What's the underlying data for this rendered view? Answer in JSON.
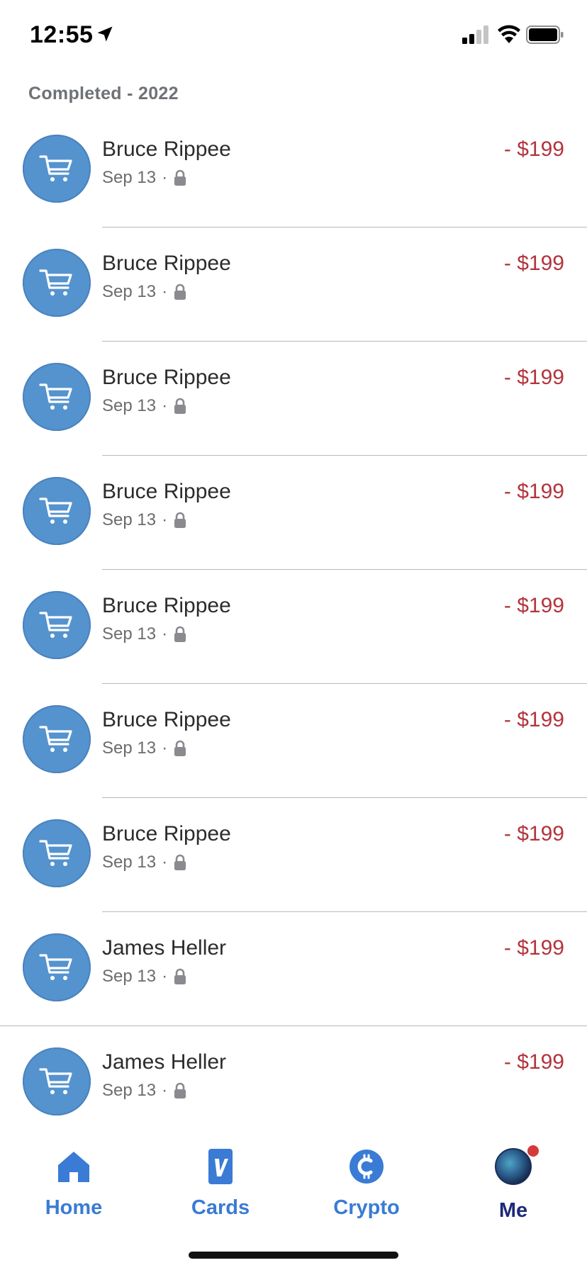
{
  "status_bar": {
    "time": "12:55"
  },
  "section": {
    "title": "Completed - 2022"
  },
  "transactions": [
    {
      "name": "Bruce Rippee",
      "date": "Sep 13",
      "separator": "·",
      "amount": "- $199"
    },
    {
      "name": "Bruce Rippee",
      "date": "Sep 13",
      "separator": "·",
      "amount": "- $199"
    },
    {
      "name": "Bruce Rippee",
      "date": "Sep 13",
      "separator": "·",
      "amount": "- $199"
    },
    {
      "name": "Bruce Rippee",
      "date": "Sep 13",
      "separator": "·",
      "amount": "- $199"
    },
    {
      "name": "Bruce Rippee",
      "date": "Sep 13",
      "separator": "·",
      "amount": "- $199"
    },
    {
      "name": "Bruce Rippee",
      "date": "Sep 13",
      "separator": "·",
      "amount": "- $199"
    },
    {
      "name": "Bruce Rippee",
      "date": "Sep 13",
      "separator": "·",
      "amount": "- $199"
    },
    {
      "name": "James Heller",
      "date": "Sep 13",
      "separator": "·",
      "amount": "- $199"
    },
    {
      "name": "James Heller",
      "date": "Sep 13",
      "separator": "·",
      "amount": "- $199"
    }
  ],
  "tabs": [
    {
      "label": "Home",
      "icon": "home-icon"
    },
    {
      "label": "Cards",
      "icon": "venmo-card-icon"
    },
    {
      "label": "Crypto",
      "icon": "crypto-icon"
    },
    {
      "label": "Me",
      "icon": "profile-avatar"
    }
  ],
  "colors": {
    "accent": "#3a7bd5",
    "avatar_bg": "#5593cf",
    "amount": "#b3343d",
    "active_tab": "#1e2a78",
    "badge": "#d33a3a"
  }
}
